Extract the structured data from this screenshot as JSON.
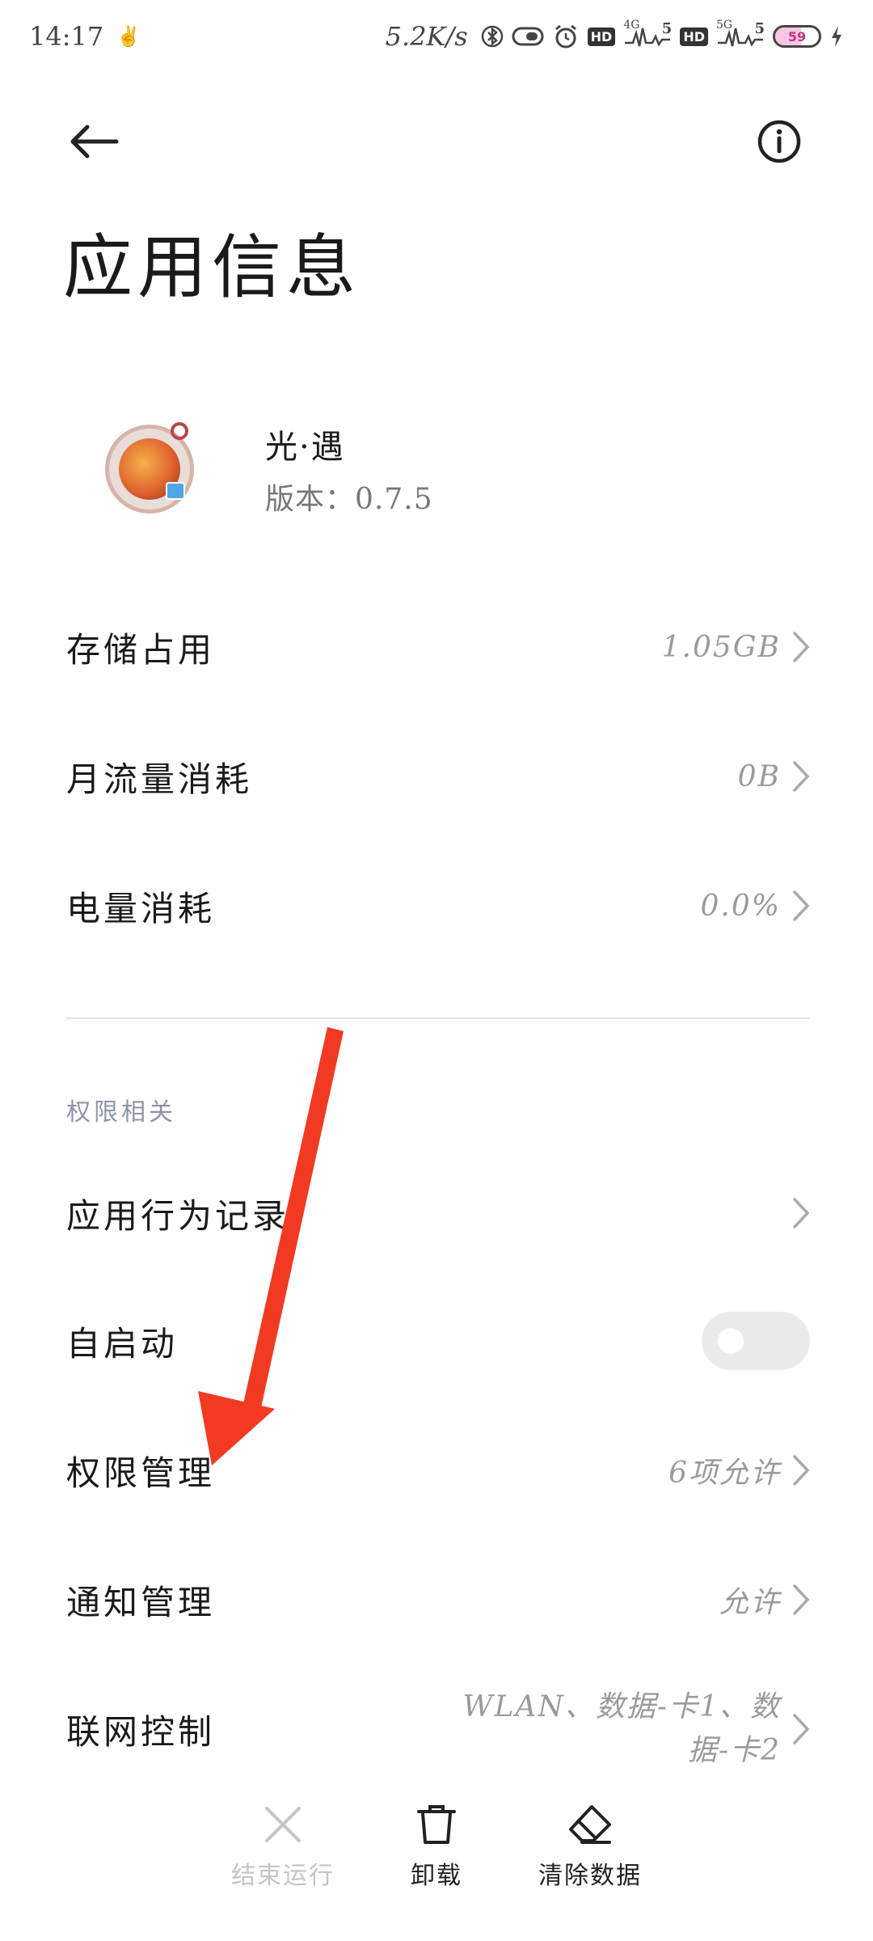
{
  "status_bar": {
    "time": "14:17",
    "net_speed": "5.2K/s",
    "hd1": "HD",
    "sig1": "4G",
    "sig1_bars": "5",
    "hd2": "HD",
    "sig2": "5G",
    "sig2_bars": "5",
    "battery": "59",
    "battery_level": 0.59
  },
  "header": {
    "title": "应用信息"
  },
  "app": {
    "name": "光·遇",
    "version": "版本：0.7.5"
  },
  "rows": {
    "storage": {
      "label": "存储占用",
      "value": "1.05GB"
    },
    "traffic": {
      "label": "月流量消耗",
      "value": "0B"
    },
    "battery": {
      "label": "电量消耗",
      "value": "0.0%"
    }
  },
  "permissions_section": {
    "header": "权限相关",
    "behavior": {
      "label": "应用行为记录"
    },
    "autostart": {
      "label": "自启动",
      "enabled": false
    },
    "permission_mgmt": {
      "label": "权限管理",
      "value": "6项允许"
    },
    "notification": {
      "label": "通知管理",
      "value": "允许"
    },
    "network": {
      "label": "联网控制",
      "value_line1": "WLAN、数据-卡1、数",
      "value_line2": "据-卡2"
    }
  },
  "bottom_bar": {
    "force_stop": "结束运行",
    "uninstall": "卸载",
    "clear_data": "清除数据"
  },
  "colors": {
    "annotation_arrow": "#f23a22",
    "section_header": "#8f93a8",
    "value_text": "#9a9a9a"
  }
}
